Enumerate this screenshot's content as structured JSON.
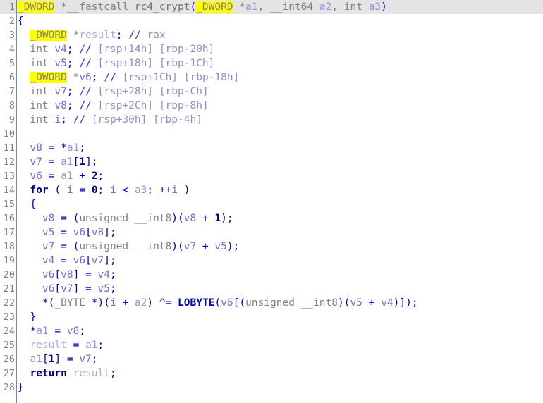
{
  "editor": {
    "app": "IDA Pro Hex-Rays Pseudocode",
    "function_name": "rc4_crypt",
    "highlighted_token": "_DWORD",
    "current_line": 1,
    "total_lines": 28,
    "colors": {
      "background": "#ffffff",
      "current_line_background": "#e4e4e4",
      "gutter_rule": "#5b8fc9",
      "line_number": "#808080",
      "type": "#808080",
      "keyword": "#000080",
      "punctuation": "#0000c0",
      "number": "#000080",
      "local_variable": "#7b68c8",
      "argument": "#9a8fd6",
      "result_variable": "#b0a8e0",
      "macro": "#0000c0",
      "comment": "#8f8fbf",
      "highlight": "#ffff00"
    }
  },
  "code": {
    "lines": [
      {
        "n": "1",
        "text": "_DWORD *__fastcall rc4_crypt(_DWORD *a1, __int64 a2, int a3)"
      },
      {
        "n": "2",
        "text": "{"
      },
      {
        "n": "3",
        "text": "  _DWORD *result; // rax"
      },
      {
        "n": "4",
        "text": "  int v4; // [rsp+14h] [rbp-20h]"
      },
      {
        "n": "5",
        "text": "  int v5; // [rsp+18h] [rbp-1Ch]"
      },
      {
        "n": "6",
        "text": "  _DWORD *v6; // [rsp+1Ch] [rbp-18h]"
      },
      {
        "n": "7",
        "text": "  int v7; // [rsp+28h] [rbp-Ch]"
      },
      {
        "n": "8",
        "text": "  int v8; // [rsp+2Ch] [rbp-8h]"
      },
      {
        "n": "9",
        "text": "  int i; // [rsp+30h] [rbp-4h]"
      },
      {
        "n": "10",
        "text": ""
      },
      {
        "n": "11",
        "text": "  v8 = *a1;"
      },
      {
        "n": "12",
        "text": "  v7 = a1[1];"
      },
      {
        "n": "13",
        "text": "  v6 = a1 + 2;"
      },
      {
        "n": "14",
        "text": "  for ( i = 0; i < a3; ++i )"
      },
      {
        "n": "15",
        "text": "  {"
      },
      {
        "n": "16",
        "text": "    v8 = (unsigned __int8)(v8 + 1);"
      },
      {
        "n": "17",
        "text": "    v5 = v6[v8];"
      },
      {
        "n": "18",
        "text": "    v7 = (unsigned __int8)(v7 + v5);"
      },
      {
        "n": "19",
        "text": "    v4 = v6[v7];"
      },
      {
        "n": "20",
        "text": "    v6[v8] = v4;"
      },
      {
        "n": "21",
        "text": "    v6[v7] = v5;"
      },
      {
        "n": "22",
        "text": "    *(_BYTE *)(i + a2) ^= LOBYTE(v6[(unsigned __int8)(v5 + v4)]);"
      },
      {
        "n": "23",
        "text": "  }"
      },
      {
        "n": "24",
        "text": "  *a1 = v8;"
      },
      {
        "n": "25",
        "text": "  result = a1;"
      },
      {
        "n": "26",
        "text": "  a1[1] = v7;"
      },
      {
        "n": "27",
        "text": "  return result;"
      },
      {
        "n": "28",
        "text": "}"
      }
    ],
    "tokens": [
      [
        {
          "t": "_DWORD",
          "c": "t-type t-hl"
        },
        {
          "t": " *__fastcall ",
          "c": "t-type"
        },
        {
          "t": "rc4_crypt",
          "c": "t-fname"
        },
        {
          "t": "(",
          "c": "t-punct"
        },
        {
          "t": "_DWORD",
          "c": "t-type t-hl"
        },
        {
          "t": " *",
          "c": "t-type"
        },
        {
          "t": "a1",
          "c": "t-arg"
        },
        {
          "t": ", ",
          "c": "t-type"
        },
        {
          "t": "__int64 ",
          "c": "t-type"
        },
        {
          "t": "a2",
          "c": "t-arg"
        },
        {
          "t": ", ",
          "c": "t-type"
        },
        {
          "t": "int ",
          "c": "t-type"
        },
        {
          "t": "a3",
          "c": "t-arg"
        },
        {
          "t": ")",
          "c": "t-punct"
        }
      ],
      [
        {
          "t": "{",
          "c": "t-brace"
        }
      ],
      [
        {
          "t": "  ",
          "c": "t-type"
        },
        {
          "t": "_DWORD",
          "c": "t-type t-hl"
        },
        {
          "t": " *",
          "c": "t-type"
        },
        {
          "t": "result",
          "c": "t-res"
        },
        {
          "t": "; ",
          "c": "t-punct"
        },
        {
          "t": "//",
          "c": "t-cmtslash"
        },
        {
          "t": " rax",
          "c": "t-cmt"
        }
      ],
      [
        {
          "t": "  int ",
          "c": "t-type"
        },
        {
          "t": "v4",
          "c": "t-lvar"
        },
        {
          "t": "; ",
          "c": "t-punct"
        },
        {
          "t": "//",
          "c": "t-cmtslash"
        },
        {
          "t": " [rsp+14h] [rbp-20h]",
          "c": "t-cmt"
        }
      ],
      [
        {
          "t": "  int ",
          "c": "t-type"
        },
        {
          "t": "v5",
          "c": "t-lvar"
        },
        {
          "t": "; ",
          "c": "t-punct"
        },
        {
          "t": "//",
          "c": "t-cmtslash"
        },
        {
          "t": " [rsp+18h] [rbp-1Ch]",
          "c": "t-cmt"
        }
      ],
      [
        {
          "t": "  ",
          "c": "t-type"
        },
        {
          "t": "_DWORD",
          "c": "t-type t-hl"
        },
        {
          "t": " *",
          "c": "t-type"
        },
        {
          "t": "v6",
          "c": "t-lvar"
        },
        {
          "t": "; ",
          "c": "t-punct"
        },
        {
          "t": "//",
          "c": "t-cmtslash"
        },
        {
          "t": " [rsp+1Ch] [rbp-18h]",
          "c": "t-cmt"
        }
      ],
      [
        {
          "t": "  int ",
          "c": "t-type"
        },
        {
          "t": "v7",
          "c": "t-lvar"
        },
        {
          "t": "; ",
          "c": "t-punct"
        },
        {
          "t": "//",
          "c": "t-cmtslash"
        },
        {
          "t": " [rsp+28h] [rbp-Ch]",
          "c": "t-cmt"
        }
      ],
      [
        {
          "t": "  int ",
          "c": "t-type"
        },
        {
          "t": "v8",
          "c": "t-lvar"
        },
        {
          "t": "; ",
          "c": "t-punct"
        },
        {
          "t": "//",
          "c": "t-cmtslash"
        },
        {
          "t": " [rsp+2Ch] [rbp-8h]",
          "c": "t-cmt"
        }
      ],
      [
        {
          "t": "  int ",
          "c": "t-type"
        },
        {
          "t": "i",
          "c": "t-lvar"
        },
        {
          "t": "; ",
          "c": "t-punct"
        },
        {
          "t": "//",
          "c": "t-cmtslash"
        },
        {
          "t": " [rsp+30h] [rbp-4h]",
          "c": "t-cmt"
        }
      ],
      [
        {
          "t": "",
          "c": "t-type"
        }
      ],
      [
        {
          "t": "  ",
          "c": "t-type"
        },
        {
          "t": "v8",
          "c": "t-lvar"
        },
        {
          "t": " = *",
          "c": "t-punct"
        },
        {
          "t": "a1",
          "c": "t-arg"
        },
        {
          "t": ";",
          "c": "t-punct"
        }
      ],
      [
        {
          "t": "  ",
          "c": "t-type"
        },
        {
          "t": "v7",
          "c": "t-lvar"
        },
        {
          "t": " = ",
          "c": "t-punct"
        },
        {
          "t": "a1",
          "c": "t-arg"
        },
        {
          "t": "[",
          "c": "t-punct"
        },
        {
          "t": "1",
          "c": "t-num"
        },
        {
          "t": "];",
          "c": "t-punct"
        }
      ],
      [
        {
          "t": "  ",
          "c": "t-type"
        },
        {
          "t": "v6",
          "c": "t-lvar"
        },
        {
          "t": " = ",
          "c": "t-punct"
        },
        {
          "t": "a1",
          "c": "t-arg"
        },
        {
          "t": " + ",
          "c": "t-punct"
        },
        {
          "t": "2",
          "c": "t-num"
        },
        {
          "t": ";",
          "c": "t-punct"
        }
      ],
      [
        {
          "t": "  ",
          "c": "t-type"
        },
        {
          "t": "for",
          "c": "t-kw"
        },
        {
          "t": " ( ",
          "c": "t-punct"
        },
        {
          "t": "i",
          "c": "t-lvar"
        },
        {
          "t": " = ",
          "c": "t-punct"
        },
        {
          "t": "0",
          "c": "t-num"
        },
        {
          "t": "; ",
          "c": "t-punct"
        },
        {
          "t": "i",
          "c": "t-lvar"
        },
        {
          "t": " < ",
          "c": "t-punct"
        },
        {
          "t": "a3",
          "c": "t-arg"
        },
        {
          "t": "; ++",
          "c": "t-punct"
        },
        {
          "t": "i",
          "c": "t-lvar"
        },
        {
          "t": " )",
          "c": "t-punct"
        }
      ],
      [
        {
          "t": "  {",
          "c": "t-brace"
        }
      ],
      [
        {
          "t": "    ",
          "c": "t-type"
        },
        {
          "t": "v8",
          "c": "t-lvar"
        },
        {
          "t": " = (",
          "c": "t-punct"
        },
        {
          "t": "unsigned __int8",
          "c": "t-type"
        },
        {
          "t": ")(",
          "c": "t-punct"
        },
        {
          "t": "v8",
          "c": "t-lvar"
        },
        {
          "t": " + ",
          "c": "t-punct"
        },
        {
          "t": "1",
          "c": "t-num"
        },
        {
          "t": ");",
          "c": "t-punct"
        }
      ],
      [
        {
          "t": "    ",
          "c": "t-type"
        },
        {
          "t": "v5",
          "c": "t-lvar"
        },
        {
          "t": " = ",
          "c": "t-punct"
        },
        {
          "t": "v6",
          "c": "t-lvar"
        },
        {
          "t": "[",
          "c": "t-punct"
        },
        {
          "t": "v8",
          "c": "t-lvar"
        },
        {
          "t": "];",
          "c": "t-punct"
        }
      ],
      [
        {
          "t": "    ",
          "c": "t-type"
        },
        {
          "t": "v7",
          "c": "t-lvar"
        },
        {
          "t": " = (",
          "c": "t-punct"
        },
        {
          "t": "unsigned __int8",
          "c": "t-type"
        },
        {
          "t": ")(",
          "c": "t-punct"
        },
        {
          "t": "v7",
          "c": "t-lvar"
        },
        {
          "t": " + ",
          "c": "t-punct"
        },
        {
          "t": "v5",
          "c": "t-lvar"
        },
        {
          "t": ");",
          "c": "t-punct"
        }
      ],
      [
        {
          "t": "    ",
          "c": "t-type"
        },
        {
          "t": "v4",
          "c": "t-lvar"
        },
        {
          "t": " = ",
          "c": "t-punct"
        },
        {
          "t": "v6",
          "c": "t-lvar"
        },
        {
          "t": "[",
          "c": "t-punct"
        },
        {
          "t": "v7",
          "c": "t-lvar"
        },
        {
          "t": "];",
          "c": "t-punct"
        }
      ],
      [
        {
          "t": "    ",
          "c": "t-type"
        },
        {
          "t": "v6",
          "c": "t-lvar"
        },
        {
          "t": "[",
          "c": "t-punct"
        },
        {
          "t": "v8",
          "c": "t-lvar"
        },
        {
          "t": "] = ",
          "c": "t-punct"
        },
        {
          "t": "v4",
          "c": "t-lvar"
        },
        {
          "t": ";",
          "c": "t-punct"
        }
      ],
      [
        {
          "t": "    ",
          "c": "t-type"
        },
        {
          "t": "v6",
          "c": "t-lvar"
        },
        {
          "t": "[",
          "c": "t-punct"
        },
        {
          "t": "v7",
          "c": "t-lvar"
        },
        {
          "t": "] = ",
          "c": "t-punct"
        },
        {
          "t": "v5",
          "c": "t-lvar"
        },
        {
          "t": ";",
          "c": "t-punct"
        }
      ],
      [
        {
          "t": "    *(",
          "c": "t-punct"
        },
        {
          "t": "_BYTE",
          "c": "t-type"
        },
        {
          "t": " *)(",
          "c": "t-punct"
        },
        {
          "t": "i",
          "c": "t-lvar"
        },
        {
          "t": " + ",
          "c": "t-punct"
        },
        {
          "t": "a2",
          "c": "t-arg"
        },
        {
          "t": ") ^= ",
          "c": "t-punct"
        },
        {
          "t": "LOBYTE",
          "c": "t-macro"
        },
        {
          "t": "(",
          "c": "t-punct"
        },
        {
          "t": "v6",
          "c": "t-lvar"
        },
        {
          "t": "[(",
          "c": "t-punct"
        },
        {
          "t": "unsigned __int8",
          "c": "t-type"
        },
        {
          "t": ")(",
          "c": "t-punct"
        },
        {
          "t": "v5",
          "c": "t-lvar"
        },
        {
          "t": " + ",
          "c": "t-punct"
        },
        {
          "t": "v4",
          "c": "t-lvar"
        },
        {
          "t": ")]);",
          "c": "t-punct"
        }
      ],
      [
        {
          "t": "  }",
          "c": "t-brace"
        }
      ],
      [
        {
          "t": "  *",
          "c": "t-punct"
        },
        {
          "t": "a1",
          "c": "t-arg"
        },
        {
          "t": " = ",
          "c": "t-punct"
        },
        {
          "t": "v8",
          "c": "t-lvar"
        },
        {
          "t": ";",
          "c": "t-punct"
        }
      ],
      [
        {
          "t": "  ",
          "c": "t-type"
        },
        {
          "t": "result",
          "c": "t-res"
        },
        {
          "t": " = ",
          "c": "t-punct"
        },
        {
          "t": "a1",
          "c": "t-arg"
        },
        {
          "t": ";",
          "c": "t-punct"
        }
      ],
      [
        {
          "t": "  ",
          "c": "t-type"
        },
        {
          "t": "a1",
          "c": "t-arg"
        },
        {
          "t": "[",
          "c": "t-punct"
        },
        {
          "t": "1",
          "c": "t-num"
        },
        {
          "t": "] = ",
          "c": "t-punct"
        },
        {
          "t": "v7",
          "c": "t-lvar"
        },
        {
          "t": ";",
          "c": "t-punct"
        }
      ],
      [
        {
          "t": "  ",
          "c": "t-type"
        },
        {
          "t": "return",
          "c": "t-kw"
        },
        {
          "t": " ",
          "c": "t-punct"
        },
        {
          "t": "result",
          "c": "t-res"
        },
        {
          "t": ";",
          "c": "t-punct"
        }
      ],
      [
        {
          "t": "}",
          "c": "t-brace"
        }
      ]
    ]
  }
}
